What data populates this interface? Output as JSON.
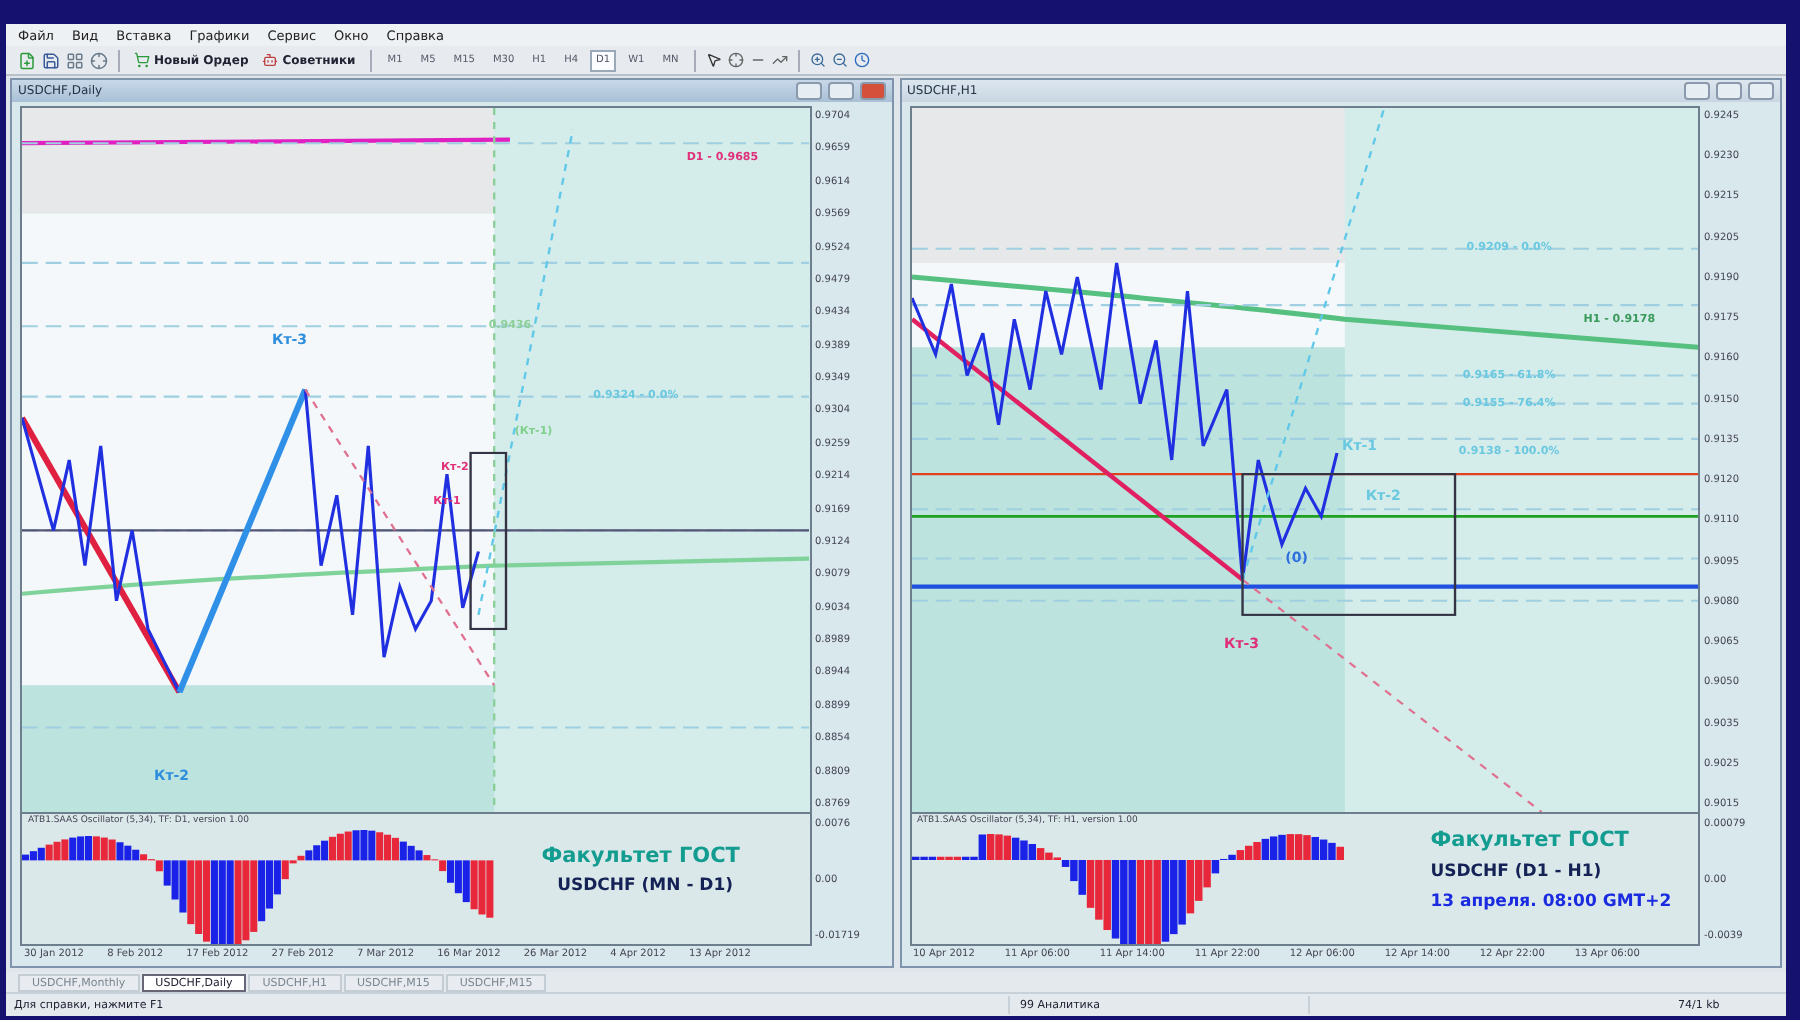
{
  "menu": [
    "Файл",
    "Вид",
    "Вставка",
    "Графики",
    "Сервис",
    "Окно",
    "Справка"
  ],
  "toolbar": {
    "order_button": "Новый Ордер",
    "experts_button": "Советники",
    "timeframes": [
      {
        "label": "M1",
        "selected": false
      },
      {
        "label": "M5",
        "selected": false
      },
      {
        "label": "M15",
        "selected": false
      },
      {
        "label": "M30",
        "selected": false
      },
      {
        "label": "H1",
        "selected": false
      },
      {
        "label": "H4",
        "selected": false
      },
      {
        "label": "D1",
        "selected": true
      },
      {
        "label": "W1",
        "selected": false
      },
      {
        "label": "MN",
        "selected": false
      }
    ]
  },
  "charts": [
    {
      "title": "USDCHF,Daily",
      "active": true,
      "labels": [
        {
          "text": "Кт-3",
          "color": "#2f8fdc"
        },
        {
          "text": "Кт-2",
          "color": "#2f8fdc"
        },
        {
          "text": "Кт-2",
          "color": "#e0307a"
        },
        {
          "text": "Кт-1",
          "color": "#e0307a"
        },
        {
          "text": "(Кт-1)",
          "color": "#7fd08a"
        },
        {
          "text": "D1 - 0.9685",
          "color": "#e0307a"
        },
        {
          "text": "0.9324 - 0.0%",
          "color": "#6ac8e0"
        },
        {
          "text": "0.9436",
          "color": "#8ccf9a"
        }
      ],
      "price_axis": [
        "0.9704",
        "0.9659",
        "0.9614",
        "0.9569",
        "0.9524",
        "0.9479",
        "0.9434",
        "0.9389",
        "0.9349",
        "0.9304",
        "0.9259",
        "0.9214",
        "0.9169",
        "0.9124",
        "0.9079",
        "0.9034",
        "0.8989",
        "0.8944",
        "0.8899",
        "0.8854",
        "0.8809",
        "0.8769"
      ],
      "oscillator_caption": "ATB1.SAAS Oscillator (5,34), TF: D1, version 1.00",
      "oscillator_axis": [
        "0.0076",
        "0.00",
        "-0.01719"
      ],
      "heading": "Факультет ГОСТ",
      "subheading": "USDCHF (MN - D1)",
      "dates": [
        "30 Jan 2012",
        "8 Feb 2012",
        "17 Feb 2012",
        "27 Feb 2012",
        "7 Mar 2012",
        "16 Mar 2012",
        "26 Mar 2012",
        "4 Apr 2012",
        "13 Apr 2012"
      ]
    },
    {
      "title": "USDCHF,H1",
      "active": false,
      "labels": [
        {
          "text": "Кт-3",
          "color": "#e0307a"
        },
        {
          "text": "Кт-1",
          "color": "#6ac8e0"
        },
        {
          "text": "Кт-2",
          "color": "#6ac8e0"
        },
        {
          "text": "(0)",
          "color": "#2f6fdc"
        },
        {
          "text": "H1 - 0.9178",
          "color": "#3a9a5a"
        },
        {
          "text": "0.9209 - 0.0%",
          "color": "#6ac8e0"
        },
        {
          "text": "0.9165 - 61.8%",
          "color": "#6ac8e0"
        },
        {
          "text": "0.9155 - 76.4%",
          "color": "#6ac8e0"
        },
        {
          "text": "0.9138 - 100.0%",
          "color": "#6ac8e0"
        }
      ],
      "price_axis": [
        "0.9245",
        "0.9230",
        "0.9215",
        "0.9205",
        "0.9190",
        "0.9175",
        "0.9160",
        "0.9150",
        "0.9135",
        "0.9120",
        "0.9110",
        "0.9095",
        "0.9080",
        "0.9065",
        "0.9050",
        "0.9035",
        "0.9025",
        "0.9015"
      ],
      "oscillator_caption": "ATB1.SAAS Oscillator (5,34), TF: H1, version 1.00",
      "oscillator_axis": [
        "0.00079",
        "0.00",
        "-0.0039"
      ],
      "heading": "Факультет ГОСТ",
      "subheading": "USDCHF (D1 - H1)",
      "note": "13 апреля. 08:00 GMT+2",
      "dates": [
        "10 Apr 2012",
        "11 Apr 06:00",
        "11 Apr 14:00",
        "11 Apr 22:00",
        "12 Apr 06:00",
        "12 Apr 14:00",
        "12 Apr 22:00",
        "13 Apr 06:00"
      ]
    }
  ],
  "tabs": [
    {
      "label": "USDCHF,Monthly",
      "selected": false
    },
    {
      "label": "USDCHF,Daily",
      "selected": true
    },
    {
      "label": "USDCHF,H1",
      "selected": false
    },
    {
      "label": "USDCHF,M15",
      "selected": false
    },
    {
      "label": "USDCHF,M15",
      "selected": false
    }
  ],
  "status_bar": {
    "help": "Для справки, нажмите F1",
    "profile": "99 Аналитика",
    "traffic": "74/1 kb"
  }
}
